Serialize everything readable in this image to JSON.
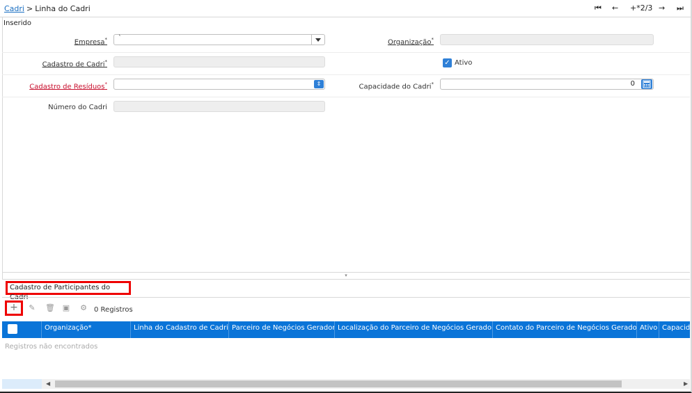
{
  "header": {
    "breadcrumb_link": "Cadri",
    "breadcrumb_sep": ">",
    "breadcrumb_current": "Linha do Cadri",
    "record_indicator": "+*2/3"
  },
  "status": "Inserido",
  "form": {
    "empresa_label": "Empresa",
    "empresa_value": "`",
    "organizacao_label": "Organização",
    "cadastro_cadri_label": "Cadastro de Cadri",
    "ativo_label": "Ativo",
    "ativo_checked": true,
    "cadastro_residuos_label": "Cadastro de Resíduos",
    "capacidade_label": "Capacidade do Cadri",
    "capacidade_value": "0",
    "numero_cadri_label": "Número do Cadri",
    "required_mark": "*"
  },
  "detail": {
    "tab_label": "Cadastro de Participantes do Cadri",
    "records_count": "0 Registros",
    "empty_text": "Registros não encontrados",
    "columns": [
      "Organização*",
      "Linha do Cadastro de Cadri*",
      "Parceiro de Negócios Gerador*",
      "Localização do Parceiro de Negócios Gerador*",
      "Contato do Parceiro de Negócios Gerador*",
      "Ativo",
      "Capacida"
    ]
  },
  "icons": {
    "nav_first": "first-record-icon",
    "nav_prev": "previous-record-icon",
    "nav_next": "next-record-icon",
    "nav_last": "last-record-icon",
    "add": "plus-icon",
    "edit": "edit-icon",
    "delete": "trash-icon",
    "save": "save-icon",
    "settings": "gear-icon"
  },
  "colors": {
    "accent": "#2f80d7",
    "grid_header": "#0a74d8",
    "required_label": "#c8102e",
    "highlight": "#e00000",
    "link": "#1a6fc2"
  }
}
